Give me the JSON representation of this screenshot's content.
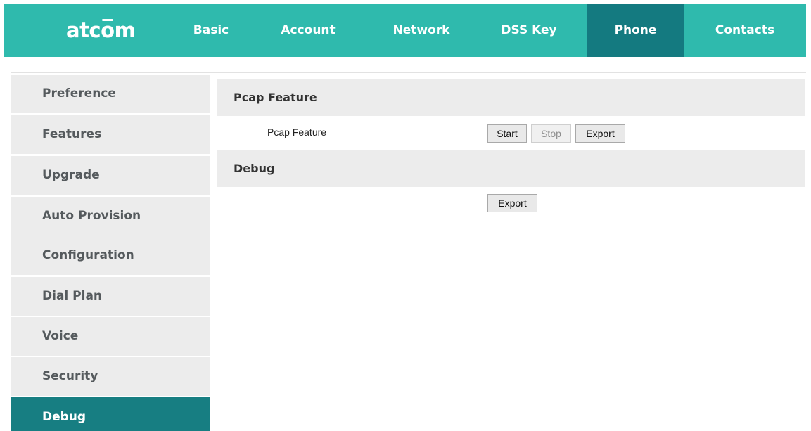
{
  "header": {
    "logo_text_a": "atc",
    "logo_text_o": "o",
    "logo_text_b": "m",
    "tabs": [
      {
        "label": "Basic",
        "active": false
      },
      {
        "label": "Account",
        "active": false
      },
      {
        "label": "Network",
        "active": false
      },
      {
        "label": "DSS Key",
        "active": false
      },
      {
        "label": "Phone",
        "active": true
      },
      {
        "label": "Contacts",
        "active": false
      }
    ]
  },
  "sidebar": {
    "items": [
      {
        "label": "Preference",
        "active": false
      },
      {
        "label": "Features",
        "active": false
      },
      {
        "label": "Upgrade",
        "active": false
      },
      {
        "label": "Auto Provision",
        "active": false
      },
      {
        "label": "Configuration",
        "active": false
      },
      {
        "label": "Dial Plan",
        "active": false
      },
      {
        "label": "Voice",
        "active": false
      },
      {
        "label": "Security",
        "active": false
      },
      {
        "label": "Debug",
        "active": true
      }
    ]
  },
  "main": {
    "pcap": {
      "title": "Pcap Feature",
      "field_label": "Pcap Feature",
      "start_label": "Start",
      "stop_label": "Stop",
      "export_label": "Export"
    },
    "debug": {
      "title": "Debug",
      "export_label": "Export"
    }
  },
  "colors": {
    "header_bg": "#2fbaad",
    "active_bg": "#147a80",
    "sidebar_bg": "#ececec",
    "sidebar_active_bg": "#177e82"
  }
}
